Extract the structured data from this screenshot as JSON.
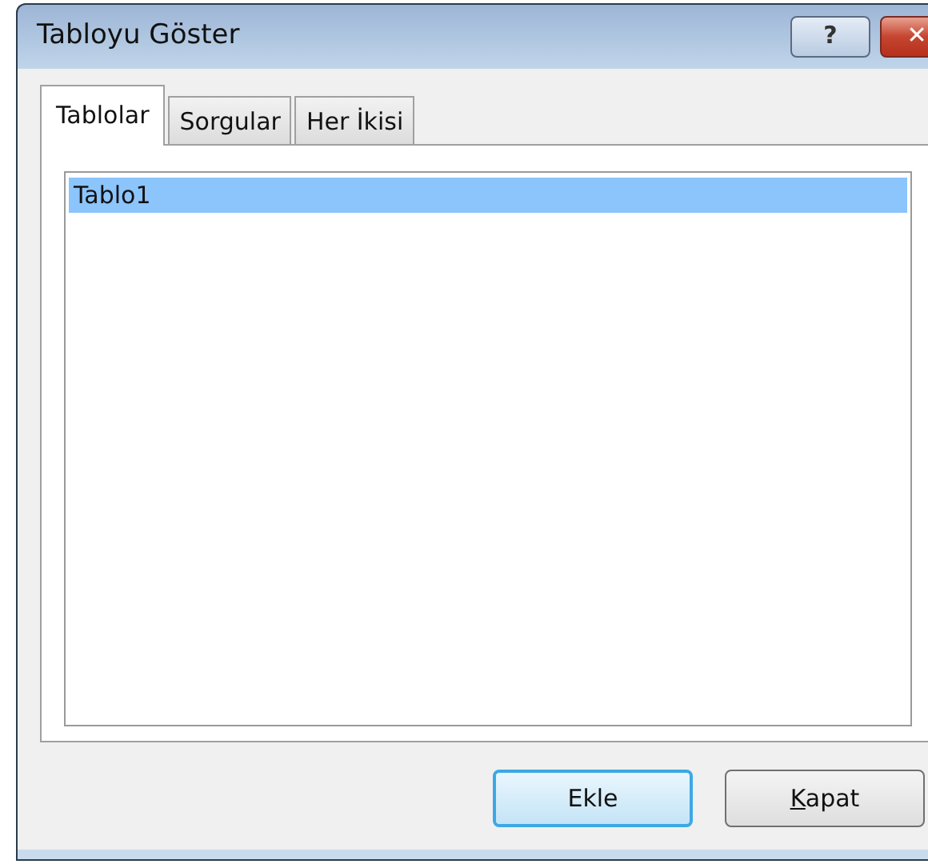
{
  "window": {
    "title": "Tabloyu Göster",
    "title_buttons": [
      {
        "kind": "help",
        "label": "?"
      },
      {
        "kind": "close",
        "label": "✕"
      }
    ]
  },
  "tabs": [
    {
      "label": "Tablolar",
      "selected": true
    },
    {
      "label": "Sorgular",
      "selected": false
    },
    {
      "label": "Her İkisi",
      "selected": false
    }
  ],
  "list": {
    "items": [
      {
        "label": "Tablo1",
        "selected": true
      }
    ]
  },
  "buttons": [
    {
      "label": "Ekle",
      "default": true,
      "underline_first": false
    },
    {
      "label": "Kapat",
      "default": false,
      "underline_first": true
    }
  ]
}
